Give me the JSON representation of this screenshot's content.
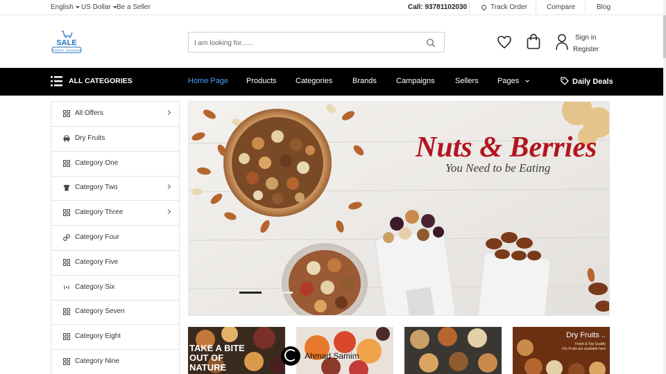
{
  "topbar": {
    "language": "English",
    "currency": "US Dollar",
    "seller": "Be a Seller",
    "call": "Call: 93781102030",
    "track": "Track Order",
    "compare": "Compare",
    "blog": "Blog"
  },
  "header": {
    "logo_text": "SALE",
    "logo_sub": "PRODUCT · ADVANTAGE",
    "search_placeholder": "I am looking for......",
    "wishlist_icon": "heart-icon",
    "cart_icon": "shopping-bag-icon",
    "user_icon": "user-icon",
    "signin": "Sign in",
    "register": "Register"
  },
  "nav": {
    "all_categories": "ALL CATEGORIES",
    "items": [
      "Home Page",
      "Products",
      "Categories",
      "Brands",
      "Campaigns",
      "Sellers",
      "Pages"
    ],
    "active": "Home Page",
    "daily_deals": "Daily Deals"
  },
  "sidebar": {
    "categories": [
      {
        "label": "All Offers",
        "icon": "grid-icon",
        "has_sub": true
      },
      {
        "label": "Dry Fruits",
        "icon": "car-icon",
        "has_sub": false
      },
      {
        "label": "Category One",
        "icon": "grid-icon",
        "has_sub": false
      },
      {
        "label": "Category Two",
        "icon": "shirt-icon",
        "has_sub": true
      },
      {
        "label": "Category Three",
        "icon": "grid-icon",
        "has_sub": true
      },
      {
        "label": "Category Four",
        "icon": "gears-icon",
        "has_sub": false
      },
      {
        "label": "Category Five",
        "icon": "grid-icon",
        "has_sub": false
      },
      {
        "label": "Category Six",
        "icon": "broadcast-icon",
        "has_sub": false
      },
      {
        "label": "Category Seven",
        "icon": "grid-icon",
        "has_sub": false
      },
      {
        "label": "Category Eight",
        "icon": "grid-icon",
        "has_sub": false
      },
      {
        "label": "Category Nine",
        "icon": "grid-icon",
        "has_sub": false
      }
    ]
  },
  "banner": {
    "title": "Nuts & Berries",
    "subtitle": "You Need to be Eating",
    "slides": 3,
    "active_slide": 2
  },
  "tiles": {
    "tile1_text": "TAKE A BITE OUT OF NATURE",
    "tile4_title": "Dry Fruits ..",
    "tile4_sub1": "Fresh & Top Quality",
    "tile4_sub2": "Dry Fruits are available here"
  },
  "watermark": "Ahmad Samim",
  "colors": {
    "nav_bg": "#000000",
    "nav_active": "#4aa3ff",
    "banner_title": "#b3141f",
    "logo_blue": "#1e6fbf"
  }
}
